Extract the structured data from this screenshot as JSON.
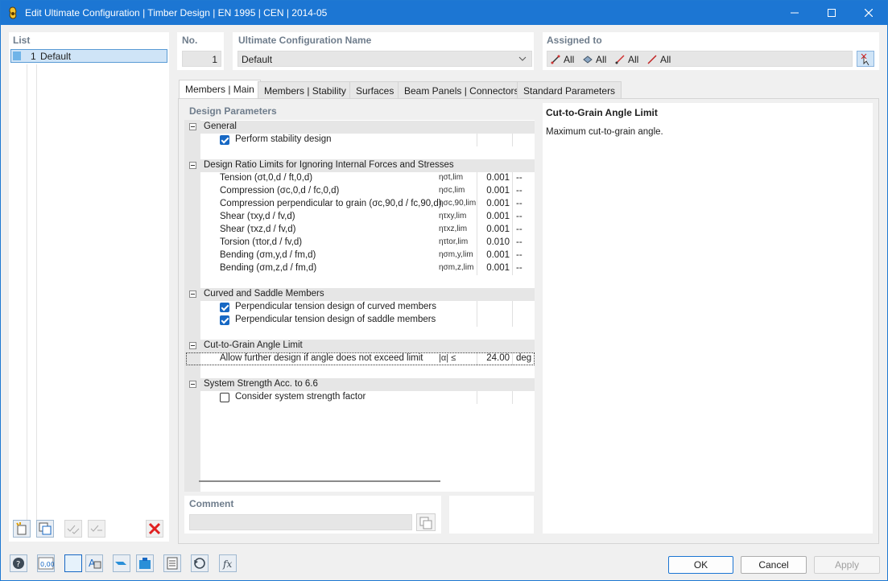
{
  "window": {
    "title": "Edit Ultimate Configuration | Timber Design | EN 1995 | CEN | 2014-05",
    "minimize_icon": "minimize-icon",
    "maximize_icon": "maximize-icon",
    "close_icon": "close-icon"
  },
  "list": {
    "header": "List",
    "items": [
      {
        "no": "1",
        "name": "Default"
      }
    ]
  },
  "no": {
    "header": "No.",
    "value": "1"
  },
  "config_name": {
    "header": "Ultimate Configuration Name",
    "value": "Default"
  },
  "assigned": {
    "header": "Assigned to",
    "items": [
      "All",
      "All",
      "All",
      "All"
    ]
  },
  "tabs": [
    "Members | Main",
    "Members | Stability",
    "Surfaces",
    "Beam Panels | Connectors",
    "Standard Parameters"
  ],
  "design_params": {
    "header": "Design Parameters",
    "general": {
      "title": "General",
      "items": [
        {
          "label": "Perform stability design",
          "checked": true
        }
      ]
    },
    "ratio": {
      "title": "Design Ratio Limits for Ignoring Internal Forces and Stresses",
      "items": [
        {
          "label": "Tension (σt,0,d / ft,0,d)",
          "symbol": "ησt,lim",
          "value": "0.001",
          "unit": "--"
        },
        {
          "label": "Compression (σc,0,d / fc,0,d)",
          "symbol": "ησc,lim",
          "value": "0.001",
          "unit": "--"
        },
        {
          "label": "Compression perpendicular to grain (σc,90,d / fc,90,d)",
          "symbol": "ησc,90,lim",
          "value": "0.001",
          "unit": "--"
        },
        {
          "label": "Shear (τxy,d / fv,d)",
          "symbol": "ητxy,lim",
          "value": "0.001",
          "unit": "--"
        },
        {
          "label": "Shear (τxz,d / fv,d)",
          "symbol": "ητxz,lim",
          "value": "0.001",
          "unit": "--"
        },
        {
          "label": "Torsion (τtor,d / fv,d)",
          "symbol": "ητtor,lim",
          "value": "0.010",
          "unit": "--"
        },
        {
          "label": "Bending (σm,y,d / fm,d)",
          "symbol": "ησm,y,lim",
          "value": "0.001",
          "unit": "--"
        },
        {
          "label": "Bending (σm,z,d / fm,d)",
          "symbol": "ησm,z,lim",
          "value": "0.001",
          "unit": "--"
        }
      ]
    },
    "curved": {
      "title": "Curved and Saddle Members",
      "items": [
        {
          "label": "Perpendicular tension design of curved members",
          "checked": true
        },
        {
          "label": "Perpendicular tension design of saddle members",
          "checked": true
        }
      ]
    },
    "cut": {
      "title": "Cut-to-Grain Angle Limit",
      "item": {
        "label": "Allow further design if angle does not exceed limit",
        "symbol": "|α| ≤",
        "value": "24.00",
        "unit": "deg"
      }
    },
    "system": {
      "title": "System Strength Acc. to 6.6",
      "items": [
        {
          "label": "Consider system strength factor",
          "checked": false
        }
      ]
    }
  },
  "description": {
    "title": "Cut-to-Grain Angle Limit",
    "text": "Maximum cut-to-grain angle."
  },
  "comment": {
    "header": "Comment",
    "value": ""
  },
  "buttons": {
    "ok": "OK",
    "cancel": "Cancel",
    "apply": "Apply"
  },
  "colors": {
    "title_bar": "#1c76d3",
    "accent": "#1768c4",
    "delete_red": "#e02020"
  }
}
